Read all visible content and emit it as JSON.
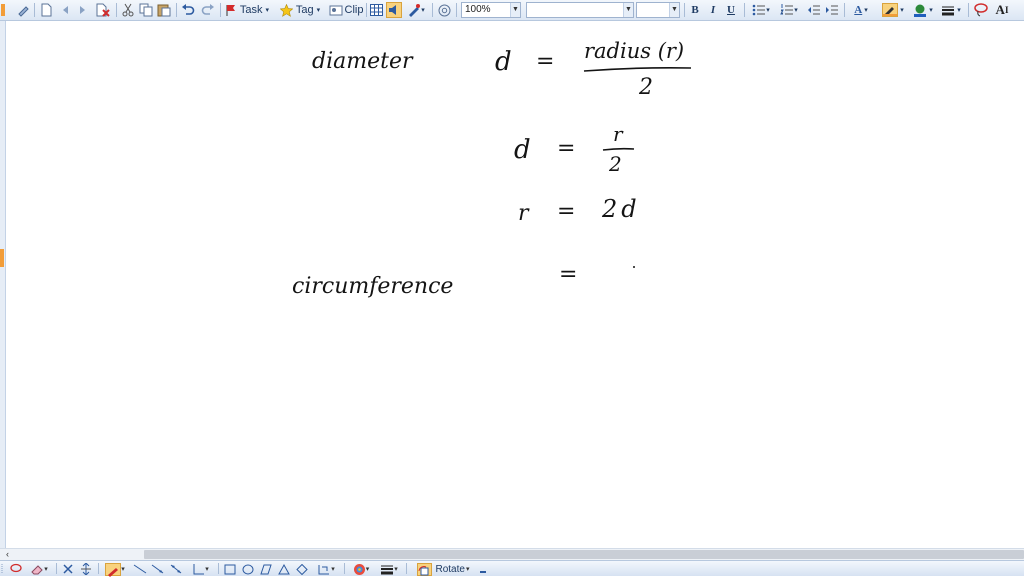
{
  "toolbar": {
    "task_label": "Task",
    "tag_label": "Tag",
    "clip_label": "Clip",
    "zoom_value": "100%",
    "font_name_value": "",
    "font_size_value": "",
    "bold_label": "B",
    "italic_label": "I",
    "underline_label": "U",
    "font_color_label": "A",
    "text_size_label": "A",
    "text_size_suffix": "I"
  },
  "canvas": {
    "line1_word": "diameter",
    "line1_var": "d",
    "line1_eq": "=",
    "line1_numerator": "radius (r)",
    "line1_denominator": "2",
    "line2_var": "d",
    "line2_eq": "=",
    "line2_numerator": "r",
    "line2_denominator": "2",
    "line3_var": "r",
    "line3_eq": "=",
    "line3_value": "2d",
    "line4_word": "circumference",
    "line4_eq": "="
  },
  "bottom_toolbar": {
    "rotate_label": "Rotate"
  },
  "colors": {
    "toolbar_bg": "#dbe6f4",
    "ink": "#141414",
    "highlight": "#f29d39"
  }
}
